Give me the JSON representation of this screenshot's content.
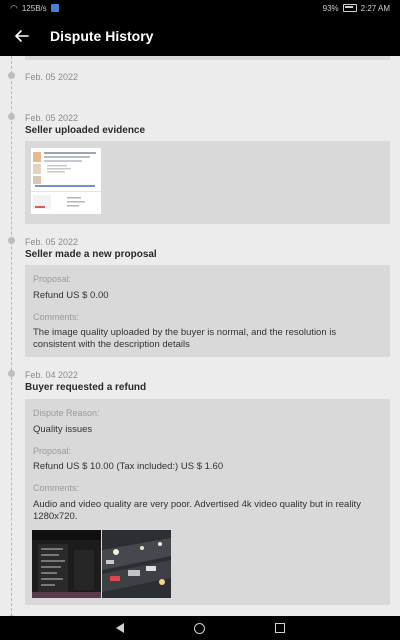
{
  "status_bar": {
    "speed": "125B/s",
    "battery": "93%",
    "time": "2:27 AM"
  },
  "app_bar": {
    "title": "Dispute History"
  },
  "timeline": {
    "entry0": {
      "date": "Feb. 05 2022"
    },
    "entry1": {
      "date": "Feb. 05 2022",
      "title": "Seller uploaded evidence"
    },
    "entry2": {
      "date": "Feb. 05 2022",
      "title": "Seller made a new proposal",
      "proposal_label": "Proposal:",
      "proposal_value": "Refund US $ 0.00",
      "comments_label": "Comments:",
      "comments_value": "The image quality uploaded by the buyer is normal, and the resolution is consistent with the description details"
    },
    "entry3": {
      "date": "Feb. 04 2022",
      "title": "Buyer requested a refund",
      "reason_label": "Dispute Reason:",
      "reason_value": "Quality issues",
      "proposal_label": "Proposal:",
      "proposal_value": "Refund US $ 10.00 (Tax included:) US $ 1.60",
      "comments_label": "Comments:",
      "comments_value": "Audio and video quality are very poor. Advertised 4k video quality but in reality 1280x720."
    }
  },
  "icons": {
    "back": "arrow-left-icon",
    "nav_back": "nav-back-icon",
    "nav_home": "nav-home-icon",
    "nav_recent": "nav-recent-icon"
  }
}
